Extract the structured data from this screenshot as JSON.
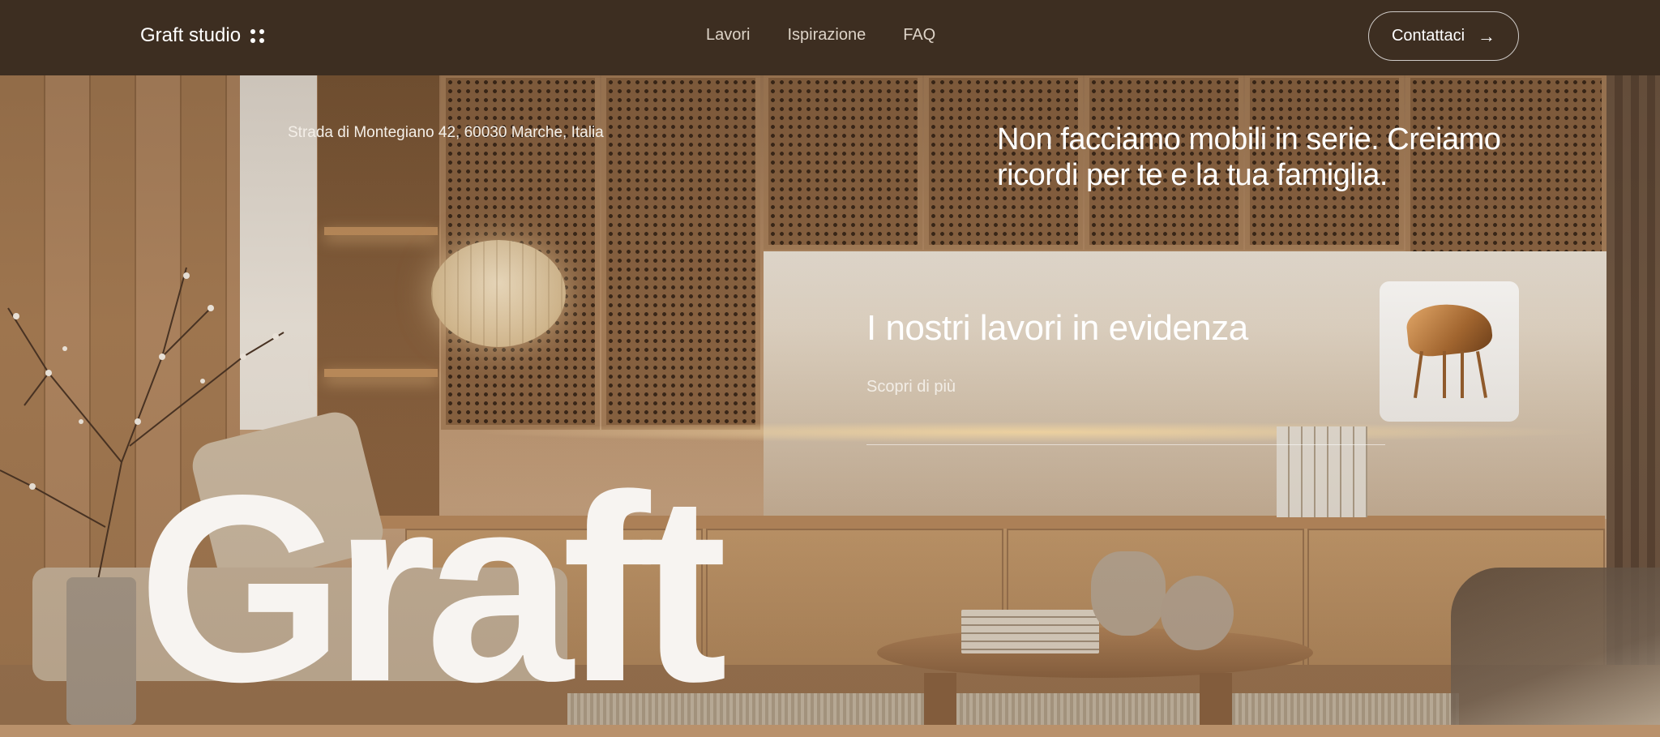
{
  "header": {
    "brand": "Graft studio",
    "nav": [
      "Lavori",
      "Ispirazione",
      "FAQ"
    ],
    "contact_label": "Contattaci",
    "contact_arrow": "→"
  },
  "hero": {
    "address": "Strada di Montegiano 42, 60030 Marche, Italia",
    "tagline": "Non facciamo mobili in serie. Creiamo ricordi per te e la tua famiglia.",
    "featured_title": "I nostri lavori in evidenza",
    "featured_link": "Scopri di più",
    "big_word": "Graft"
  },
  "icons": {
    "brand_mark": "four-dots-icon",
    "contact_arrow": "arrow-right-icon"
  },
  "colors": {
    "header_bg": "#3d2e21",
    "text_light": "#ffffff"
  }
}
